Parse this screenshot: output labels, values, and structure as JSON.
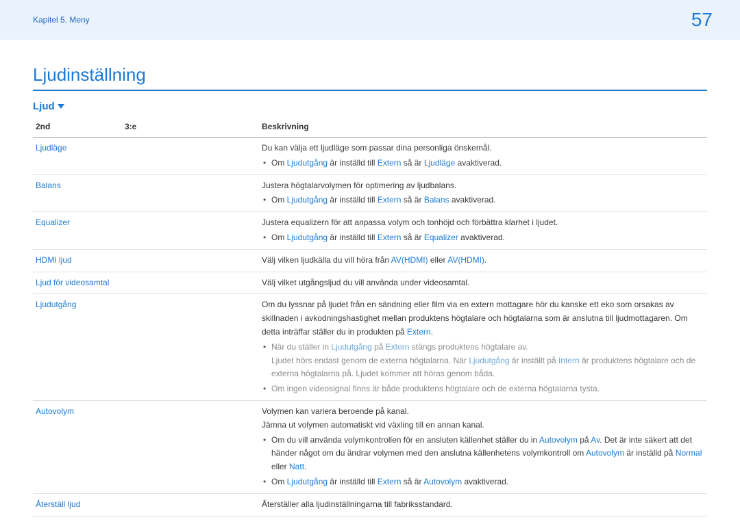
{
  "header": {
    "chapter": "Kapitel 5. Meny",
    "page_number": "57"
  },
  "title": "Ljudinställning",
  "subtitle": "Ljud",
  "columns": {
    "c2nd": "2nd",
    "c3e": "3:e",
    "cdesc": "Beskrivning"
  },
  "rows": {
    "ljudlage": {
      "label": "Ljudläge",
      "desc": "Du kan välja ett ljudläge som passar dina personliga önskemål.",
      "bullet1_a": "Om ",
      "bullet1_b": "Ljudutgång",
      "bullet1_c": " är inställd till ",
      "bullet1_d": "Extern",
      "bullet1_e": " så är ",
      "bullet1_f": "Ljudläge",
      "bullet1_g": " avaktiverad."
    },
    "balans": {
      "label": "Balans",
      "desc": "Justera högtalarvolymen för optimering av ljudbalans.",
      "bullet1_a": "Om ",
      "bullet1_b": "Ljudutgång",
      "bullet1_c": " är inställd till ",
      "bullet1_d": "Extern",
      "bullet1_e": " så är ",
      "bullet1_f": "Balans",
      "bullet1_g": " avaktiverad."
    },
    "equalizer": {
      "label": "Equalizer",
      "desc": "Justera equalizern för att anpassa volym och tonhöjd och förbättra klarhet i ljudet.",
      "bullet1_a": "Om ",
      "bullet1_b": "Ljudutgång",
      "bullet1_c": " är inställd till ",
      "bullet1_d": "Extern",
      "bullet1_e": " så är ",
      "bullet1_f": "Equalizer",
      "bullet1_g": " avaktiverad."
    },
    "hdmi": {
      "label": "HDMI ljud",
      "desc_a": "Välj vilken ljudkälla du vill höra från ",
      "desc_b": "AV(HDMI)",
      "desc_c": " eller ",
      "desc_d": "AV(HDMI)",
      "desc_e": "."
    },
    "videosamtal": {
      "label": "Ljud för videosamtal",
      "desc": "Välj vilket utgångsljud du vill använda under videosamtal."
    },
    "ljudutgang": {
      "label": "Ljudutgång",
      "desc_a": "Om du lyssnar på ljudet från en sändning eller film via en extern mottagare hör du kanske ett eko som orsakas av skillnaden i avkodningshastighet mellan produktens högtalare och högtalarna som är anslutna till ljudmottagaren. Om detta inträffar ställer du in produkten på ",
      "desc_b": "Extern",
      "desc_c": ".",
      "bullet1_a": "När du ställer in ",
      "bullet1_b": "Ljudutgång",
      "bullet1_c": " på ",
      "bullet1_d": "Extern",
      "bullet1_e": " stängs produktens högtalare av.",
      "bullet1_line2_a": "Ljudet hörs endast genom de externa högtalarna. När ",
      "bullet1_line2_b": "Ljudutgång",
      "bullet1_line2_c": " är inställt på ",
      "bullet1_line2_d": "Intern",
      "bullet1_line2_e": " är produktens högtalare och de externa högtalarna på. Ljudet kommer att höras genom båda.",
      "bullet2": "Om ingen videosignal finns är både produktens högtalare och de externa högtalarna tysta."
    },
    "autovolym": {
      "label": "Autovolym",
      "desc1": "Volymen kan variera beroende på kanal.",
      "desc2": "Jämna ut volymen automatiskt vid växling till en annan kanal.",
      "bullet1_a": "Om du vill använda volymkontrollen för en ansluten källenhet ställer du in ",
      "bullet1_b": "Autovolym",
      "bullet1_c": " på ",
      "bullet1_d": "Av",
      "bullet1_e": ". Det är inte säkert att det händer något om du ändrar volymen med den anslutna källenhetens volymkontroll om ",
      "bullet1_f": "Autovolym",
      "bullet1_g": " är inställd på ",
      "bullet1_h": "Normal",
      "bullet1_i": " eller ",
      "bullet1_j": "Natt",
      "bullet1_k": ".",
      "bullet2_a": "Om ",
      "bullet2_b": "Ljudutgång",
      "bullet2_c": " är inställd till ",
      "bullet2_d": "Extern",
      "bullet2_e": " så är ",
      "bullet2_f": "Autovolym",
      "bullet2_g": " avaktiverad."
    },
    "aterstall": {
      "label": "Återställ ljud",
      "desc": "Återställer alla ljudinställningarna till fabriksstandard."
    }
  }
}
